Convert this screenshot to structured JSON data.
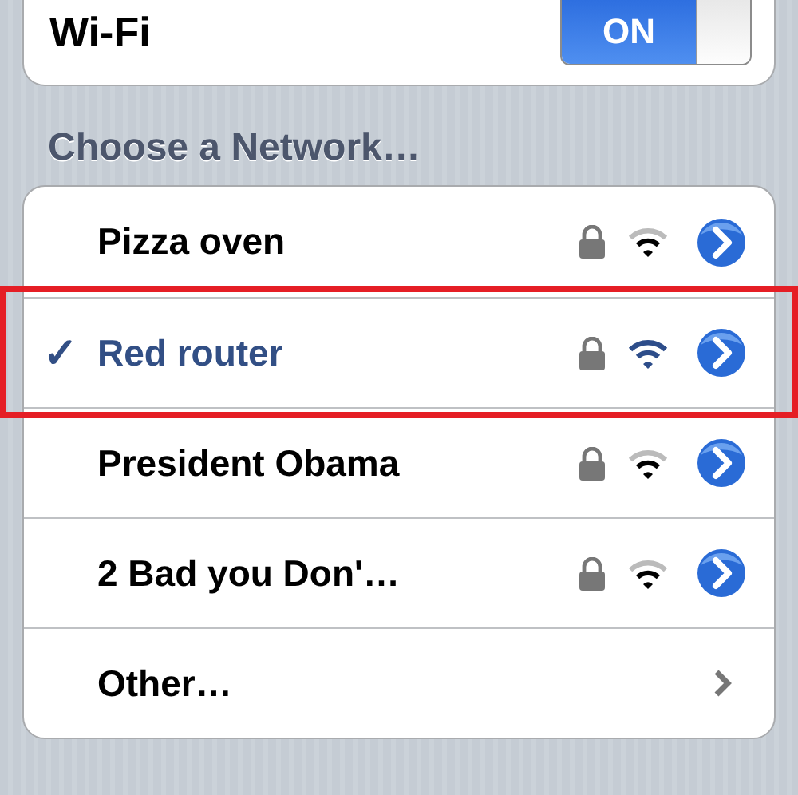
{
  "wifi": {
    "label": "Wi-Fi",
    "on": true,
    "on_label": "ON"
  },
  "section_header": "Choose a Network…",
  "networks": [
    {
      "kind": "network",
      "name": "Pizza oven",
      "selected": false,
      "locked": true,
      "highlighted": false
    },
    {
      "kind": "network",
      "name": "Red router",
      "selected": true,
      "locked": true,
      "highlighted": true,
      "check": "✓"
    },
    {
      "kind": "network",
      "name": "President Obama",
      "selected": false,
      "locked": true,
      "highlighted": false
    },
    {
      "kind": "network",
      "name": "2 Bad you Don'…",
      "selected": false,
      "locked": true,
      "highlighted": false
    },
    {
      "kind": "other",
      "name": "Other…"
    }
  ]
}
